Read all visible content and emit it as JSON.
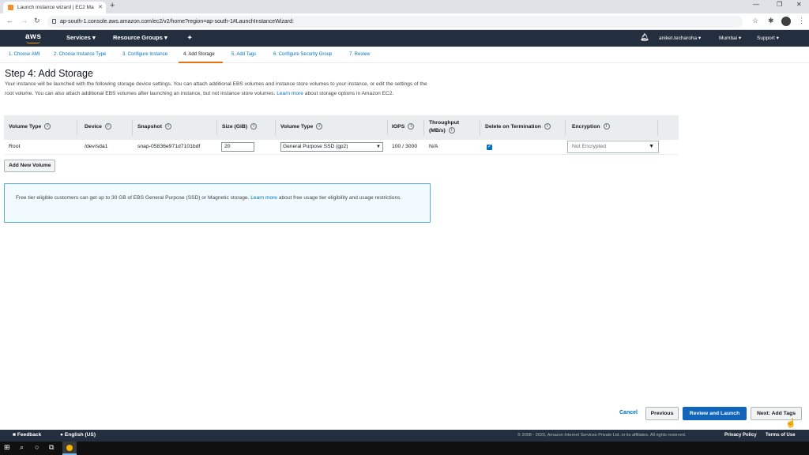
{
  "browser": {
    "tab_title": "Launch instance wizard | EC2 Ma",
    "url": "ap-south-1.console.aws.amazon.com/ec2/v2/home?region=ap-south-1#LaunchInstanceWizard:"
  },
  "aws_nav": {
    "logo": "aws",
    "services": "Services",
    "resource_groups": "Resource Groups",
    "user": "aniket.techaroha",
    "region": "Mumbai",
    "support": "Support"
  },
  "steps": [
    {
      "label": "1. Choose AMI",
      "active": false
    },
    {
      "label": "2. Choose Instance Type",
      "active": false
    },
    {
      "label": "3. Configure Instance",
      "active": false
    },
    {
      "label": "4. Add Storage",
      "active": true
    },
    {
      "label": "5. Add Tags",
      "active": false
    },
    {
      "label": "6. Configure Security Group",
      "active": false
    },
    {
      "label": "7. Review",
      "active": false
    }
  ],
  "page": {
    "title": "Step 4: Add Storage",
    "desc_part1": "Your instance will be launched with the following storage device settings. You can attach additional EBS volumes and instance store volumes to your instance, or edit the settings of the root volume. You can also attach additional EBS volumes after launching an instance, but not instance store volumes.",
    "desc_link": "Learn more",
    "desc_part2": "about storage options in Amazon EC2."
  },
  "table": {
    "headers": {
      "volume_type": "Volume Type",
      "device": "Device",
      "snapshot": "Snapshot",
      "size": "Size (GiB)",
      "vol_type": "Volume Type",
      "iops": "IOPS",
      "throughput": "Throughput (MB/s)",
      "delete": "Delete on Termination",
      "encryption": "Encryption"
    },
    "row": {
      "volume_type": "Root",
      "device": "/dev/sda1",
      "snapshot": "snap-05836e971d7101bdf",
      "size": "20",
      "vol_type": "General Purpose SSD (gp2)",
      "iops": "100 / 3000",
      "throughput": "N/A",
      "delete_checked": true,
      "encryption": "Not Encrypted"
    }
  },
  "add_volume": "Add New Volume",
  "info": {
    "part1": "Free tier eligible customers can get up to 30 GB of EBS General Purpose (SSD) or Magnetic storage.",
    "link": "Learn more",
    "part2": "about free usage tier eligibility and usage restrictions."
  },
  "footer_buttons": {
    "cancel": "Cancel",
    "previous": "Previous",
    "review": "Review and Launch",
    "next": "Next: Add Tags"
  },
  "aws_footer": {
    "feedback": "Feedback",
    "language": "English (US)",
    "copyright": "© 2008 - 2020, Amazon Internet Services Private Ltd. or its affiliates. All rights reserved.",
    "privacy": "Privacy Policy",
    "terms": "Terms of Use"
  },
  "colors": {
    "aws_nav": "#232f3e",
    "accent": "#ec7211",
    "link": "#0073bb",
    "primary_button": "#1166bb"
  }
}
